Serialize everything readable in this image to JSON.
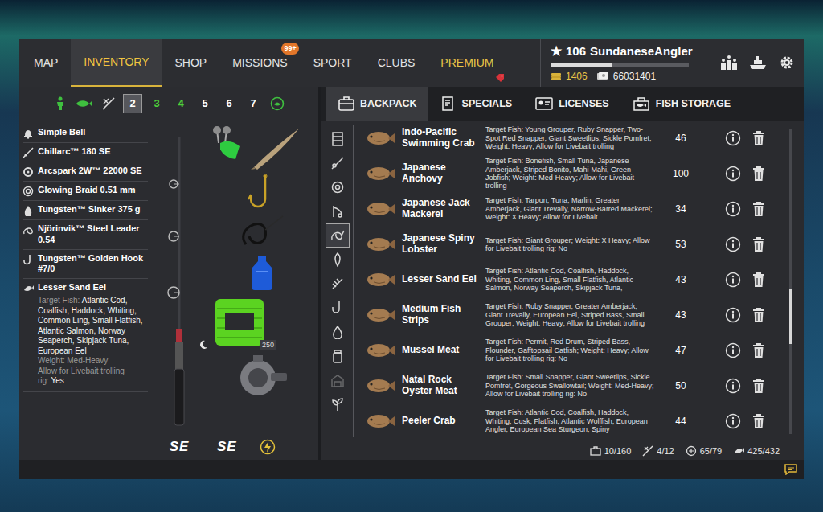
{
  "nav": {
    "tabs": [
      {
        "label": "MAP",
        "selected": false,
        "kind": "normal"
      },
      {
        "label": "INVENTORY",
        "selected": true,
        "kind": "normal"
      },
      {
        "label": "SHOP",
        "selected": false,
        "kind": "normal"
      },
      {
        "label": "MISSIONS",
        "selected": false,
        "kind": "normal",
        "badge": "99+"
      },
      {
        "label": "SPORT",
        "selected": false,
        "kind": "normal"
      },
      {
        "label": "CLUBS",
        "selected": false,
        "kind": "normal"
      },
      {
        "label": "PREMIUM",
        "selected": false,
        "kind": "premium"
      }
    ]
  },
  "player": {
    "rank_icon": "★",
    "level": "106",
    "name": "SundaneseAngler",
    "xp": {
      "level": 0.45
    },
    "gold": "1406",
    "silver": "66031401"
  },
  "rod_slots": [
    {
      "label": "2",
      "selected": true,
      "color": "#ffffff"
    },
    {
      "label": "3",
      "selected": false,
      "color": "#4ccf3a"
    },
    {
      "label": "4",
      "selected": false,
      "color": "#4ccf3a"
    },
    {
      "label": "5",
      "selected": false,
      "color": "#ffffff"
    },
    {
      "label": "6",
      "selected": false,
      "color": "#ffffff"
    },
    {
      "label": "7",
      "selected": false,
      "color": "#ffffff"
    }
  ],
  "equipment": [
    {
      "name": "Simple Bell"
    },
    {
      "name": "Chillarc™ 180 SE"
    },
    {
      "name": "Arcspark 2W™ 22000 SE"
    },
    {
      "name": "Glowing Braid 0.51 mm"
    },
    {
      "name": "Tungsten™ Sinker 375 g"
    },
    {
      "name": "Njörinvik™ Steel Leader 0.54"
    },
    {
      "name": "Tungsten™ Golden Hook #7/0"
    },
    {
      "name": "Lesser Sand Eel",
      "details": {
        "target_label": "Target Fish:",
        "target": "Atlantic Cod, Coalfish, Haddock, Whiting, Common Ling, Small Flatfish, Atlantic Salmon, Norway Seaperch, Skipjack Tuna, European Eel",
        "weight_label": "Weight:",
        "weight": "Med-Heavy",
        "livebait_label": "Allow for Livebait trolling rig:",
        "livebait": "Yes"
      }
    }
  ],
  "rod": {
    "line_count": "250",
    "rod_brand": "SE",
    "reel_brand": "SE"
  },
  "panel_tabs": [
    {
      "label": "BACKPACK",
      "selected": true
    },
    {
      "label": "SPECIALS",
      "selected": false
    },
    {
      "label": "LICENSES",
      "selected": false
    },
    {
      "label": "FISH STORAGE",
      "selected": false
    }
  ],
  "categories": [
    {
      "selected": false,
      "disabled": false
    },
    {
      "selected": false,
      "disabled": false
    },
    {
      "selected": false,
      "disabled": false
    },
    {
      "selected": false,
      "disabled": false
    },
    {
      "selected": true,
      "disabled": false
    },
    {
      "selected": false,
      "disabled": false
    },
    {
      "selected": false,
      "disabled": false
    },
    {
      "selected": false,
      "disabled": false
    },
    {
      "selected": false,
      "disabled": false
    },
    {
      "selected": false,
      "disabled": false
    },
    {
      "selected": false,
      "disabled": true
    },
    {
      "selected": false,
      "disabled": false
    }
  ],
  "items": [
    {
      "name": "Indo-Pacific Swimming Crab",
      "description": "Target Fish: Young Grouper, Ruby Snapper, Two-Spot Red Snapper, Giant Sweetlips, Sickle Pomfret; Weight: Heavy; Allow for Livebait trolling",
      "count": "46"
    },
    {
      "name": "Japanese Anchovy",
      "description": "Target Fish: Bonefish, Small Tuna, Japanese Amberjack, Striped Bonito, Mahi-Mahi, Green Jobfish; Weight: Med-Heavy; Allow for Livebait trolling",
      "count": "100"
    },
    {
      "name": "Japanese Jack Mackerel",
      "description": "Target Fish: Tarpon, Tuna, Marlin, Greater Amberjack, Giant Trevally, Narrow-Barred Mackerel; Weight: X Heavy; Allow for Livebait",
      "count": "34"
    },
    {
      "name": "Japanese Spiny Lobster",
      "description": "Target Fish: Giant Grouper; Weight: X Heavy; Allow for Livebait trolling rig: No",
      "count": "53"
    },
    {
      "name": "Lesser Sand Eel",
      "description": "Target Fish: Atlantic Cod, Coalfish, Haddock, Whiting, Common Ling, Small Flatfish, Atlantic Salmon, Norway Seaperch, Skipjack Tuna,",
      "count": "43"
    },
    {
      "name": "Medium Fish Strips",
      "description": "Target Fish: Ruby Snapper, Greater Amberjack, Giant Trevally, European Eel, Striped Bass, Small Grouper; Weight: Heavy; Allow for Livebait trolling",
      "count": "43"
    },
    {
      "name": "Mussel Meat",
      "description": "Target Fish: Permit, Red Drum, Striped Bass, Flounder, Gafftopsail Catfish; Weight: Heavy; Allow for Livebait trolling rig: No",
      "count": "47"
    },
    {
      "name": "Natal Rock Oyster Meat",
      "description": "Target Fish: Small Snapper, Giant Sweetlips, Sickle Pomfret, Gorgeous Swallowtail; Weight: Med-Heavy; Allow for Livebait trolling rig: No",
      "count": "50"
    },
    {
      "name": "Peeler Crab",
      "description": "Target Fish: Atlantic Cod, Coalfish, Haddock, Whiting, Cusk, Flatfish, Atlantic Wolffish, European Angler, European Sea Sturgeon, Spiny",
      "count": "44"
    }
  ],
  "scrollbar": {
    "level": 0.64
  },
  "capacity": [
    "10/160",
    "4/12",
    "65/79",
    "425/432"
  ]
}
